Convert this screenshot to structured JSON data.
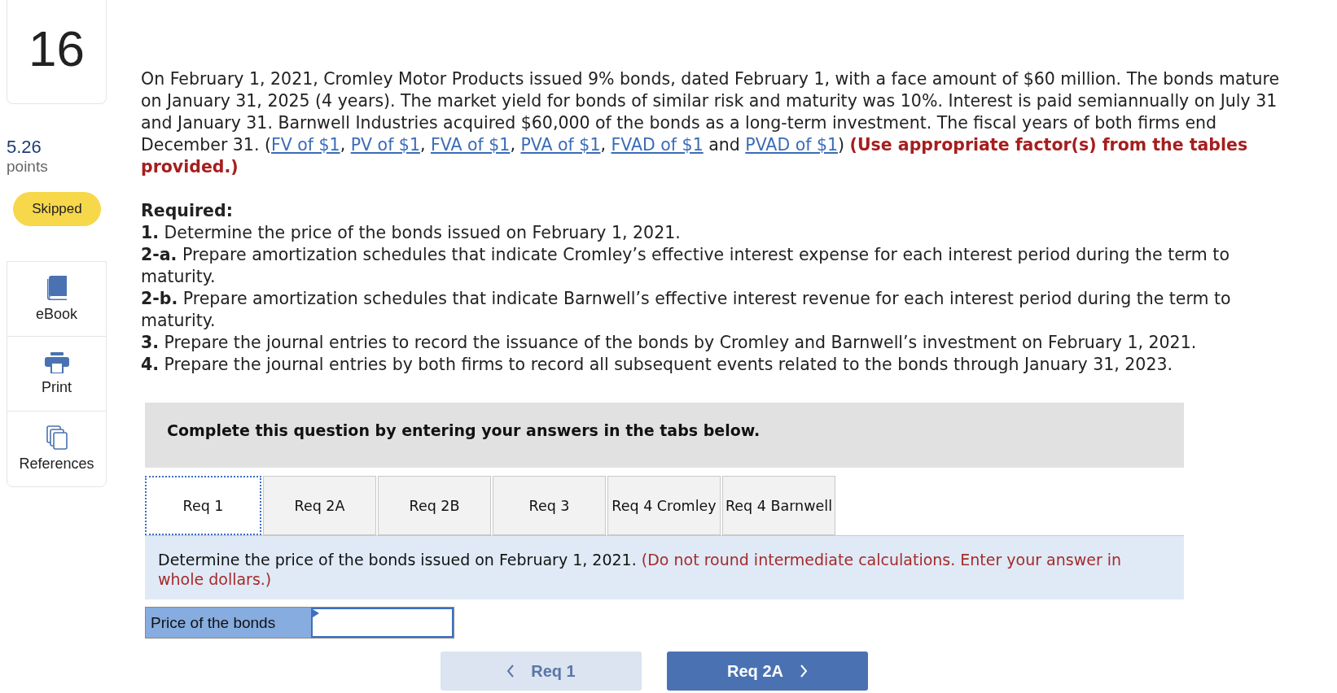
{
  "sidebar": {
    "question_number": "16",
    "points": "5.26",
    "points_label": "points",
    "status": "Skipped",
    "tools": [
      {
        "kind": "ebook",
        "label": "eBook"
      },
      {
        "kind": "print",
        "label": "Print"
      },
      {
        "kind": "references",
        "label": "References"
      }
    ]
  },
  "problem": {
    "segments": [
      {
        "kind": "text",
        "text": "On February 1, 2021, Cromley Motor Products issued 9% bonds, dated February 1, with a face amount of $60 million. The bonds mature on January 31, 2025 (4 years). The market yield for bonds of similar risk and maturity was 10%. Interest is paid semiannually on July 31 and January 31. Barnwell Industries acquired $60,000 of the bonds as a long-term investment. The fiscal years of both firms end December 31. ("
      },
      {
        "kind": "link",
        "text": "FV of $1"
      },
      {
        "kind": "text",
        "text": ", "
      },
      {
        "kind": "link",
        "text": "PV of $1"
      },
      {
        "kind": "text",
        "text": ", "
      },
      {
        "kind": "link",
        "text": "FVA of $1"
      },
      {
        "kind": "text",
        "text": ", "
      },
      {
        "kind": "link",
        "text": "PVA of $1"
      },
      {
        "kind": "text",
        "text": ", "
      },
      {
        "kind": "link",
        "text": "FVAD of $1"
      },
      {
        "kind": "text",
        "text": " and "
      },
      {
        "kind": "link",
        "text": "PVAD of $1"
      },
      {
        "kind": "text",
        "text": ") "
      },
      {
        "kind": "note",
        "text": "(Use appropriate factor(s) from the tables provided.)"
      }
    ],
    "required_heading": "Required:",
    "requirements": [
      {
        "number": "1.",
        "text": "Determine the price of the bonds issued on February 1, 2021."
      },
      {
        "number": "2-a.",
        "text": "Prepare amortization schedules that indicate Cromley’s effective interest expense for each interest period during the term to maturity."
      },
      {
        "number": "2-b.",
        "text": "Prepare amortization schedules that indicate Barnwell’s effective interest revenue for each interest period during the term to maturity."
      },
      {
        "number": "3.",
        "text": "Prepare the journal entries to record the issuance of the bonds by Cromley and Barnwell’s investment on February 1, 2021."
      },
      {
        "number": "4.",
        "text": "Prepare the journal entries by both firms to record all subsequent events related to the bonds through January 31, 2023."
      }
    ]
  },
  "answer_panel": {
    "instruction": "Complete this question by entering your answers in the tabs below.",
    "tabs": [
      {
        "label": "Req 1",
        "selected": true
      },
      {
        "label": "Req 2A",
        "selected": false
      },
      {
        "label": "Req 2B",
        "selected": false
      },
      {
        "label": "Req 3",
        "selected": false
      },
      {
        "label": "Req 4 Cromley",
        "selected": false
      },
      {
        "label": "Req 4 Barnwell",
        "selected": false
      }
    ],
    "prompt": "Determine the price of the bonds issued on February 1, 2021.",
    "prompt_note": "(Do not round intermediate calculations. Enter your answer in whole dollars.)",
    "answer_label": "Price of the bonds",
    "previous_button": {
      "label": "Req 1",
      "disabled": true
    },
    "next_button": {
      "label": "Req 2A",
      "disabled": false
    }
  }
}
